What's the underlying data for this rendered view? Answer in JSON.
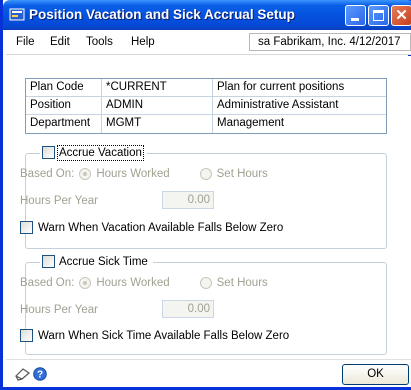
{
  "window": {
    "title": "Position Vacation and Sick Accrual Setup",
    "controls": {
      "minimize": "minimize-icon",
      "maximize": "maximize-icon",
      "close": "✕"
    }
  },
  "menubar": {
    "items": [
      "File",
      "Edit",
      "Tools",
      "Help"
    ],
    "user_info": "sa  Fabrikam, Inc.  4/12/2017"
  },
  "plan_grid": {
    "rows": [
      {
        "label": "Plan Code",
        "value": "*CURRENT",
        "description": "Plan for current positions"
      },
      {
        "label": "Position",
        "value": "ADMIN",
        "description": "Administrative Assistant"
      },
      {
        "label": "Department",
        "value": "MGMT",
        "description": "Management"
      }
    ]
  },
  "vacation": {
    "checkbox_label": "Accrue Vacation",
    "checked": false,
    "based_on_label": "Based On:",
    "option_hours_worked": "Hours Worked",
    "option_set_hours": "Set Hours",
    "hours_per_year_label": "Hours Per Year",
    "hours_per_year_value": "0.00",
    "warn_label": "Warn When Vacation Available Falls Below Zero"
  },
  "sick": {
    "checkbox_label": "Accrue Sick Time",
    "checked": false,
    "based_on_label": "Based On:",
    "option_hours_worked": "Hours Worked",
    "option_set_hours": "Set Hours",
    "hours_per_year_label": "Hours Per Year",
    "hours_per_year_value": "0.00",
    "warn_label": "Warn When Sick Time Available Falls Below Zero"
  },
  "footer": {
    "ok_label": "OK",
    "icons": [
      "note-icon",
      "help-icon"
    ]
  },
  "colors": {
    "titlebar": "#0553e0",
    "disabled_text": "#a1a192",
    "close_button": "#c8401c"
  }
}
